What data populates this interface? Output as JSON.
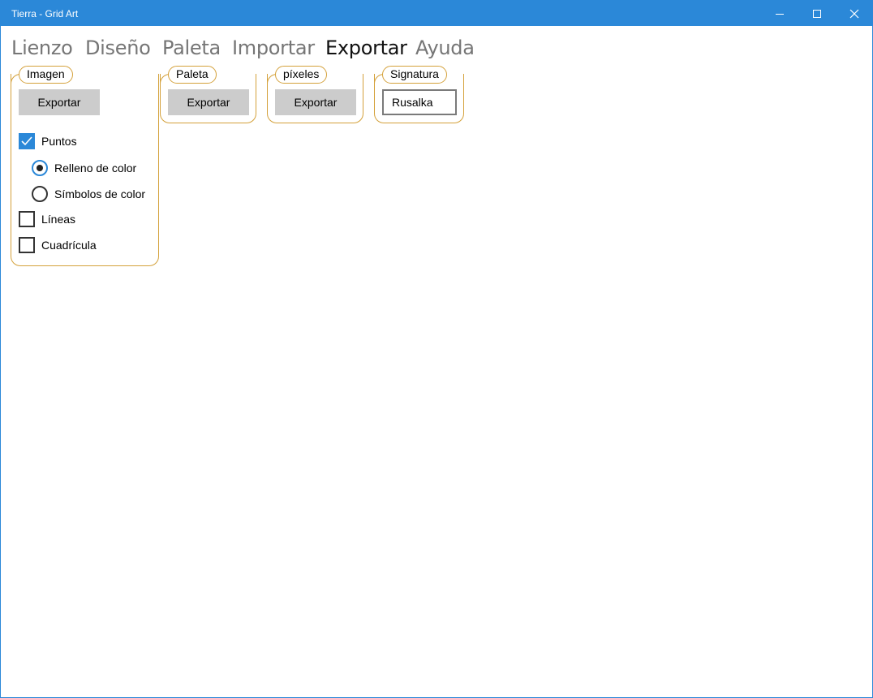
{
  "window": {
    "title": "Tierra - Grid Art",
    "minimize_icon": "minimize-icon",
    "maximize_icon": "maximize-icon",
    "close_icon": "close-icon",
    "accent_color": "#2b88d8"
  },
  "menu": {
    "items": [
      "Lienzo",
      "Diseño",
      "Paleta",
      "Importar",
      "Exportar",
      "Ayuda"
    ],
    "active": "Exportar"
  },
  "groups": {
    "imagen": {
      "label": "Imagen",
      "export_button": "Exportar",
      "points_label": "Puntos",
      "points_checked": true,
      "fill_label": "Relleno de color",
      "fill_selected": true,
      "symbols_label": "Símbolos de color",
      "symbols_selected": false,
      "lines_label": "Líneas",
      "lines_checked": false,
      "grid_label": "Cuadrícula",
      "grid_checked": false
    },
    "paleta": {
      "label": "Paleta",
      "export_button": "Exportar"
    },
    "pixeles": {
      "label": "píxeles",
      "export_button": "Exportar"
    },
    "signatura": {
      "label": "Signatura",
      "value": "Rusalka"
    }
  },
  "colors": {
    "group_border": "#d4a13b",
    "button_bg": "#cccccc",
    "check_accent": "#2b88d8"
  }
}
